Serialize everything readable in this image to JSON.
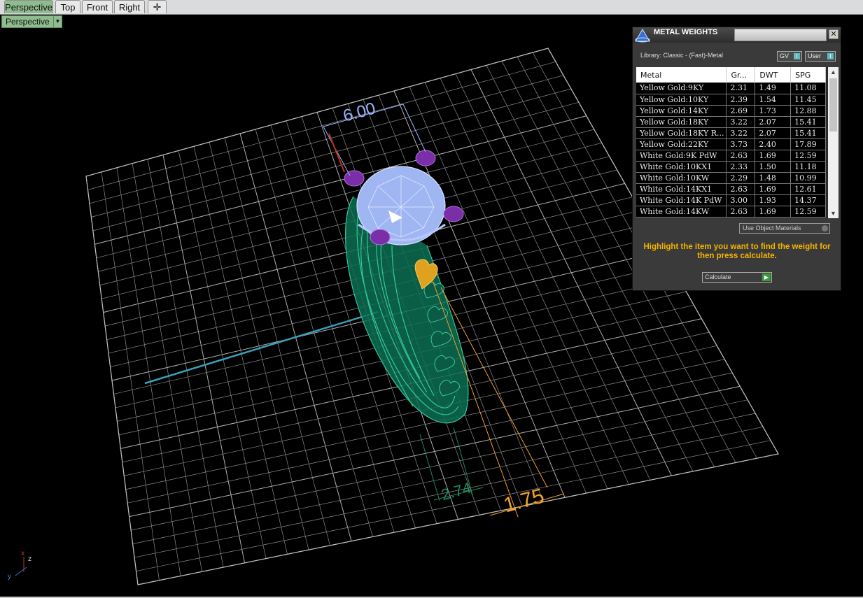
{
  "tabs": [
    "Perspective",
    "Top",
    "Front",
    "Right"
  ],
  "viewport": {
    "name_dropdown": "Perspective",
    "dimensions": {
      "top_width": "6.00",
      "band_width": "2.74",
      "side_width": "1.75"
    },
    "axis_labels": {
      "x": "x",
      "y": "y",
      "z": "z"
    }
  },
  "panel": {
    "title": "METAL WEIGHTS",
    "library": "Library: Classic - (Fast)-Metal",
    "toggle_gv": "GV",
    "toggle_user": "User",
    "columns": [
      "Metal",
      "Gr...",
      "DWT",
      "SPG"
    ],
    "rows": [
      [
        "Yellow Gold:9KY",
        "2.31",
        "1.49",
        "11.08"
      ],
      [
        "Yellow Gold:10KY",
        "2.39",
        "1.54",
        "11.45"
      ],
      [
        "Yellow Gold:14KY",
        "2.69",
        "1.73",
        "12.88"
      ],
      [
        "Yellow Gold:18KY",
        "3.22",
        "2.07",
        "15.41"
      ],
      [
        "Yellow Gold:18KY R...",
        "3.22",
        "2.07",
        "15.41"
      ],
      [
        "Yellow Gold:22KY",
        "3.73",
        "2.40",
        "17.89"
      ],
      [
        "White Gold:9K PdW",
        "2.63",
        "1.69",
        "12.59"
      ],
      [
        "White Gold:10KX1",
        "2.33",
        "1.50",
        "11.18"
      ],
      [
        "White Gold:10KW",
        "2.29",
        "1.48",
        "10.99"
      ],
      [
        "White Gold:14KX1",
        "2.63",
        "1.69",
        "12.61"
      ],
      [
        "White Gold:14K PdW",
        "3.00",
        "1.93",
        "14.37"
      ],
      [
        "White Gold:14KW",
        "2.63",
        "1.69",
        "12.59"
      ]
    ],
    "use_object_materials": "Use Object Materials",
    "hint": "Highlight the item you want to find the weight for then press calculate.",
    "calculate": "Calculate"
  }
}
